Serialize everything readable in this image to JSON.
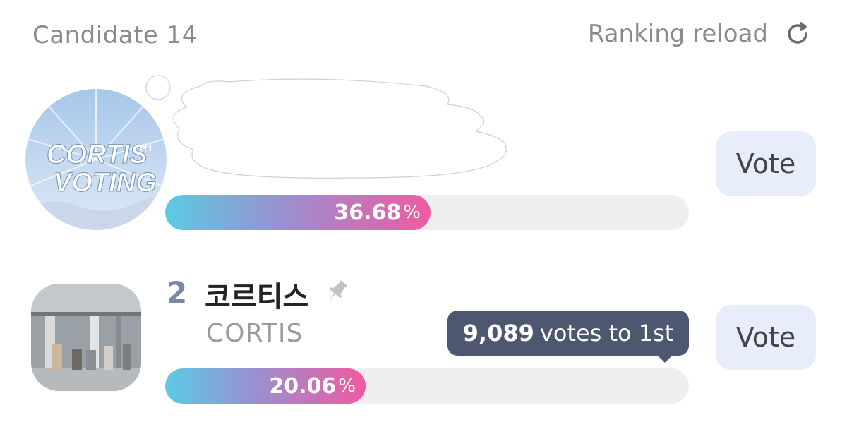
{
  "header": {
    "candidate_count": "Candidate 14",
    "reload_label": "Ranking reload",
    "reload_icon": "reload-icon"
  },
  "rows": [
    {
      "avatar_text_1": "CORTIS",
      "avatar_text_sup": "TH",
      "avatar_text_2": "VOTING",
      "percent": "36.68",
      "percent_sign": "%",
      "progress": 0.3668,
      "vote_label": "Vote"
    },
    {
      "rank": "2",
      "name": "코르티스",
      "subname": "CORTIS",
      "pin_icon": "pin-icon",
      "tooltip_count": "9,089",
      "tooltip_text": "votes to 1st",
      "percent": "20.06",
      "percent_sign": "%",
      "progress": 0.2006,
      "vote_label": "Vote"
    }
  ],
  "colors": {
    "bar_gradient_start": "#5bcbe3",
    "bar_gradient_mid": "#9a8fd0",
    "bar_gradient_end": "#f05aa0",
    "vote_button_bg": "#e8edfb",
    "tooltip_bg": "#4d5870",
    "rank_color": "#7a87a8"
  }
}
